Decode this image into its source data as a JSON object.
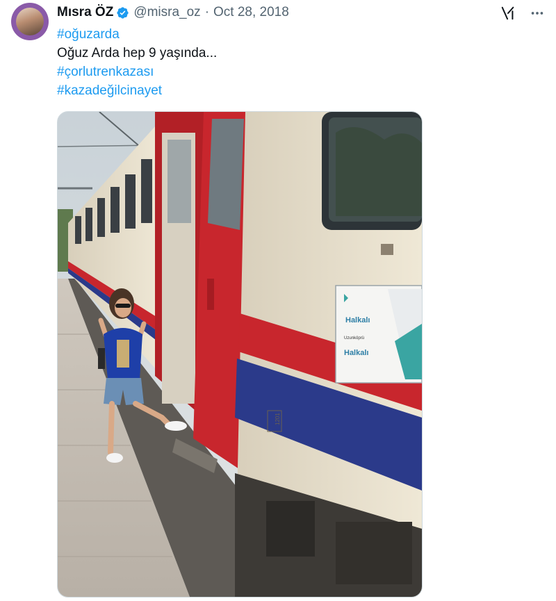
{
  "tweet": {
    "author": {
      "display_name": "Mısra ÖZ",
      "handle": "@misra_oz",
      "verified": true,
      "avatar_icon": "profile-photo"
    },
    "separator": "·",
    "date": "Oct 28, 2018",
    "lines": [
      {
        "text": "#oğuzarda",
        "kind": "hashtag"
      },
      {
        "text": "Oğuz Arda hep 9 yaşında...",
        "kind": "plain"
      },
      {
        "text": "#çorlutrenkazası",
        "kind": "hashtag"
      },
      {
        "text": "#kazadeğilcinayet",
        "kind": "hashtag"
      }
    ],
    "media": {
      "type": "photo",
      "sign_lines": [
        "Halkalı",
        "Uzunköprü",
        "Halkalı"
      ],
      "car_number": "1201"
    },
    "actions": {
      "grok_icon": "grok-icon",
      "more_icon": "more-dots-icon"
    }
  },
  "colors": {
    "link": "#1d9bf0",
    "text": "#0f1419",
    "secondary": "#536471",
    "verified": "#1d9bf0",
    "train_red": "#c8262d",
    "train_blue": "#2b3a8a",
    "train_cream": "#e9e2cf"
  }
}
